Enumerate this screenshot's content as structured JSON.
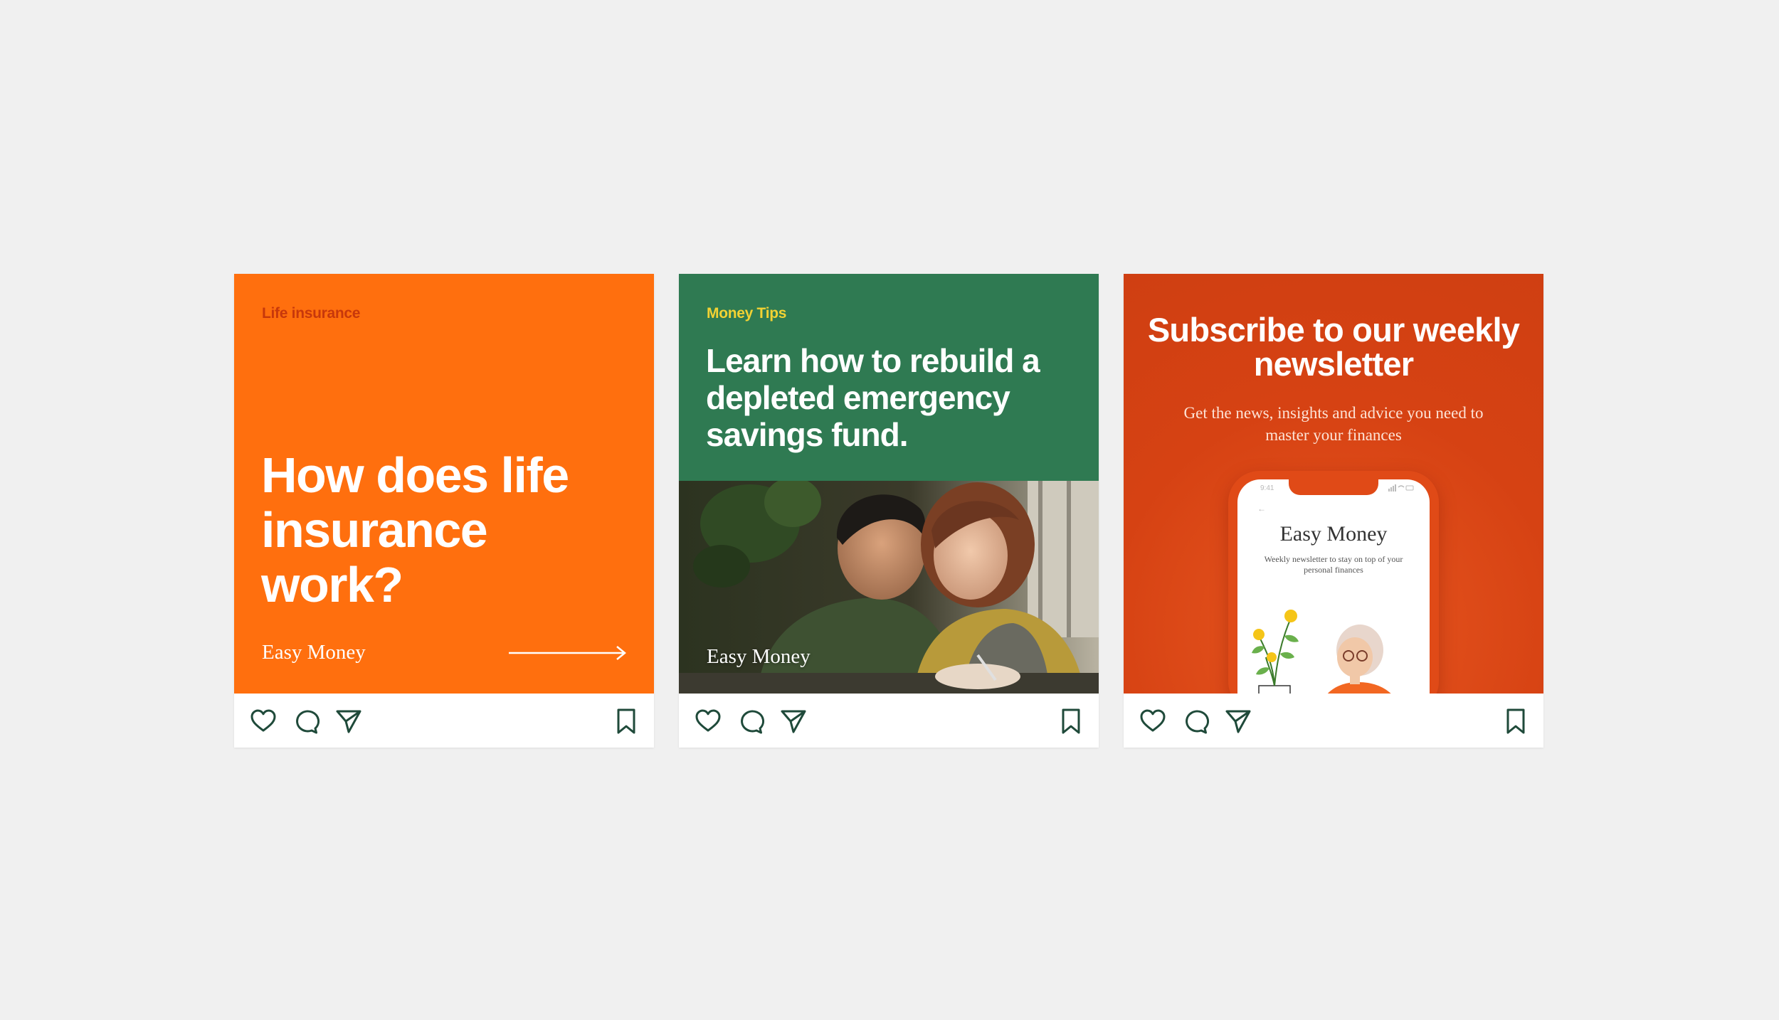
{
  "colors": {
    "page_bg": "#f0f0f0",
    "orange": "#ff6f0e",
    "green": "#2f7a52",
    "red_orange": "#d64213",
    "yellow": "#f2d233",
    "icon_stroke": "#1f4a3a"
  },
  "posts": [
    {
      "category": "Life insurance",
      "headline": "How does life insurance work?",
      "brand": "Easy Money",
      "actions": [
        "heart-icon",
        "comment-icon",
        "send-icon",
        "bookmark-icon"
      ]
    },
    {
      "category": "Money Tips",
      "headline": "Learn how to rebuild a depleted emergency savings fund.",
      "brand": "Easy Money",
      "actions": [
        "heart-icon",
        "comment-icon",
        "send-icon",
        "bookmark-icon"
      ]
    },
    {
      "headline": "Subscribe to our weekly newsletter",
      "subtitle": "Get the news, insights and advice you need to master your finances",
      "phone": {
        "time": "9:41",
        "app_title": "Easy Money",
        "app_description": "Weekly newsletter to stay on top of your personal finances"
      },
      "actions": [
        "heart-icon",
        "comment-icon",
        "send-icon",
        "bookmark-icon"
      ]
    }
  ]
}
